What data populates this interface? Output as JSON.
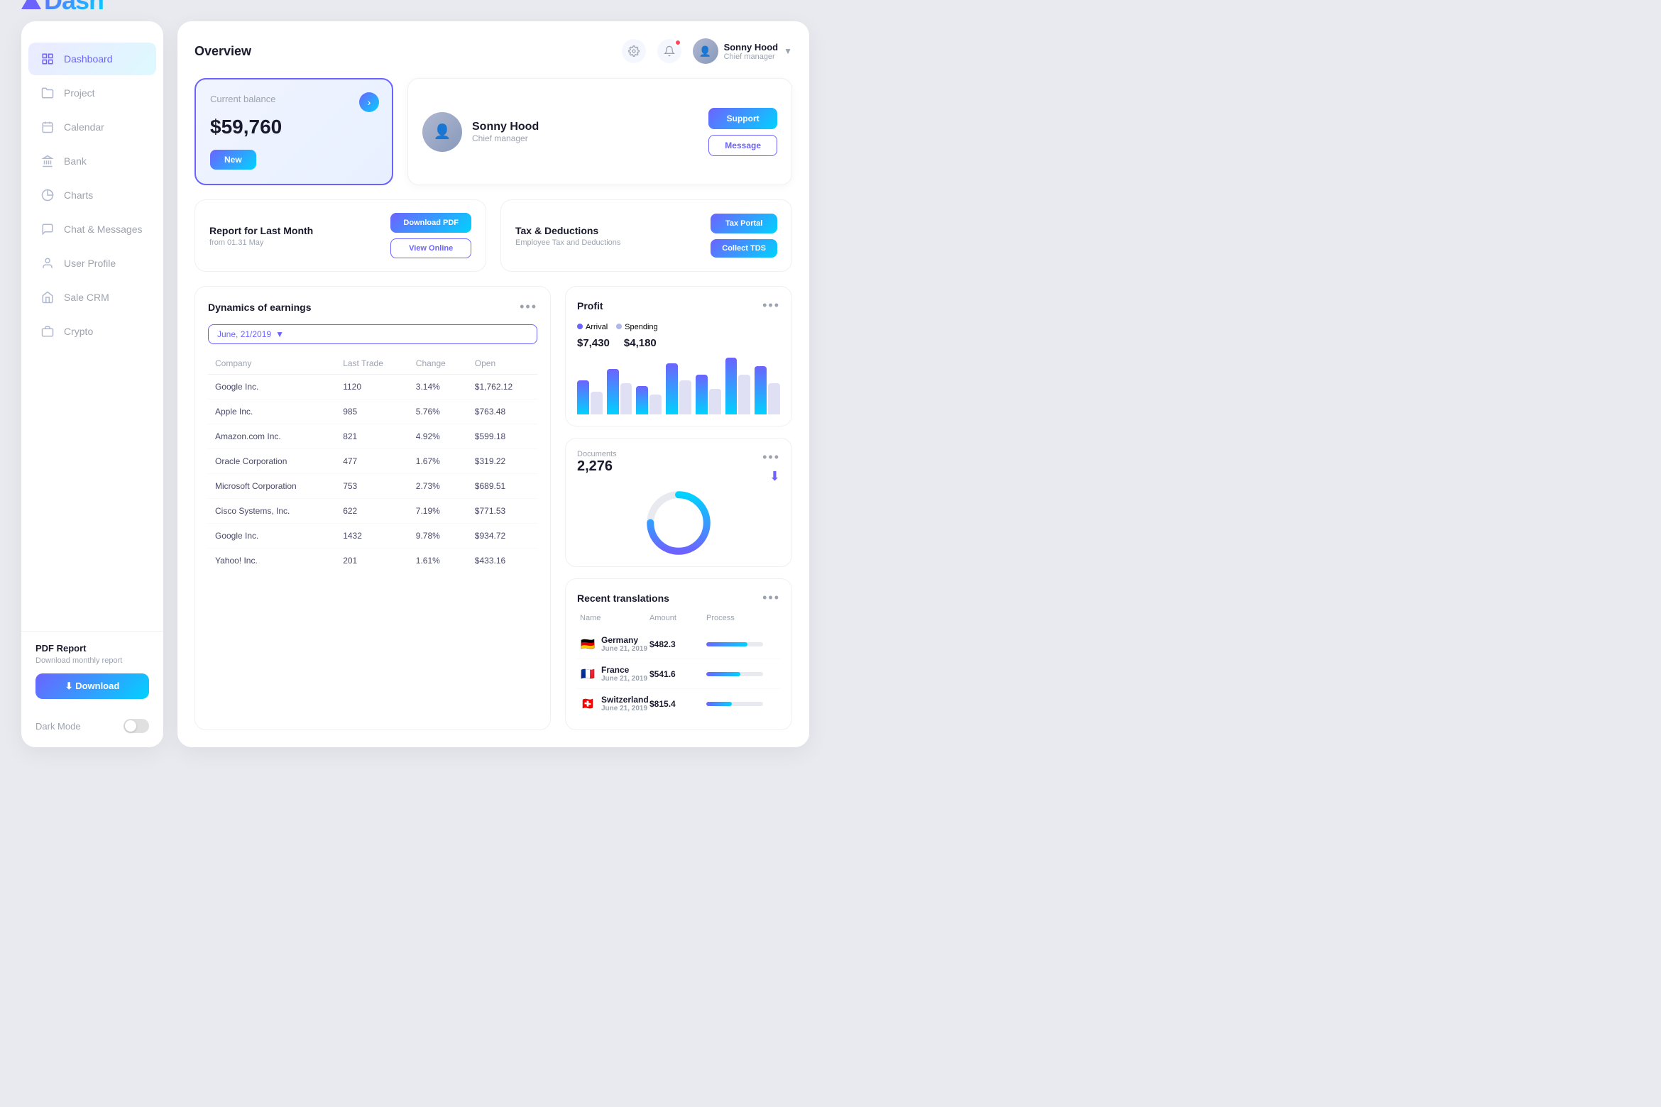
{
  "logo": {
    "text": "Dash"
  },
  "sidebar": {
    "items": [
      {
        "label": "Dashboard",
        "icon": "dashboard-icon",
        "active": true
      },
      {
        "label": "Project",
        "icon": "project-icon",
        "active": false
      },
      {
        "label": "Calendar",
        "icon": "calendar-icon",
        "active": false
      },
      {
        "label": "Bank",
        "icon": "bank-icon",
        "active": false
      },
      {
        "label": "Charts",
        "icon": "charts-icon",
        "active": false
      },
      {
        "label": "Chat & Messages",
        "icon": "chat-icon",
        "active": false
      },
      {
        "label": "User Profile",
        "icon": "user-icon",
        "active": false
      },
      {
        "label": "Sale CRM",
        "icon": "crm-icon",
        "active": false
      },
      {
        "label": "Crypto",
        "icon": "crypto-icon",
        "active": false
      }
    ],
    "pdf_report": {
      "title": "PDF Report",
      "subtitle": "Download monthly report",
      "button_label": "⬇ Download"
    },
    "dark_mode": {
      "label": "Dark Mode"
    }
  },
  "header": {
    "title": "Overview",
    "user": {
      "name": "Sonny Hood",
      "role": "Chief manager"
    }
  },
  "balance_card": {
    "label": "Current balance",
    "amount": "$59,760",
    "button_label": "New"
  },
  "user_card": {
    "name": "Sonny Hood",
    "role": "Chief manager",
    "support_btn": "Support",
    "message_btn": "Message"
  },
  "report_card": {
    "title": "Report for Last Month",
    "subtitle": "from 01.31 May",
    "download_btn": "Download PDF",
    "view_btn": "View Online"
  },
  "tax_card": {
    "title": "Tax & Deductions",
    "subtitle": "Employee Tax and Deductions",
    "portal_btn": "Tax Portal",
    "collect_btn": "Collect TDS"
  },
  "earnings": {
    "title": "Dynamics of earnings",
    "date_select": "June, 21/2019",
    "columns": [
      "Company",
      "Last Trade",
      "Change",
      "Open"
    ],
    "rows": [
      {
        "company": "Google Inc.",
        "last_trade": "1120",
        "change": "3.14%",
        "open": "$1,762.12"
      },
      {
        "company": "Apple Inc.",
        "last_trade": "985",
        "change": "5.76%",
        "open": "$763.48"
      },
      {
        "company": "Amazon.com Inc.",
        "last_trade": "821",
        "change": "4.92%",
        "open": "$599.18"
      },
      {
        "company": "Oracle Corporation",
        "last_trade": "477",
        "change": "1.67%",
        "open": "$319.22"
      },
      {
        "company": "Microsoft Corporation",
        "last_trade": "753",
        "change": "2.73%",
        "open": "$689.51"
      },
      {
        "company": "Cisco Systems, Inc.",
        "last_trade": "622",
        "change": "7.19%",
        "open": "$771.53"
      },
      {
        "company": "Google Inc.",
        "last_trade": "1432",
        "change": "9.78%",
        "open": "$934.72"
      },
      {
        "company": "Yahoo! Inc.",
        "last_trade": "201",
        "change": "1.61%",
        "open": "$433.16"
      }
    ]
  },
  "profit": {
    "title": "Profit",
    "arrival_label": "Arrival",
    "spending_label": "Spending",
    "arrival_value": "$7,430",
    "spending_value": "$4,180",
    "bars": [
      {
        "arrival": 60,
        "spending": 40
      },
      {
        "arrival": 80,
        "spending": 55
      },
      {
        "arrival": 50,
        "spending": 35
      },
      {
        "arrival": 90,
        "spending": 60
      },
      {
        "arrival": 70,
        "spending": 45
      },
      {
        "arrival": 100,
        "spending": 70
      },
      {
        "arrival": 85,
        "spending": 55
      }
    ]
  },
  "document": {
    "title": "Document",
    "label": "Documents",
    "count": "2,276",
    "donut_percent": 75
  },
  "translations": {
    "title": "Recent translations",
    "columns": [
      "Name",
      "Amount",
      "Process"
    ],
    "rows": [
      {
        "country": "Germany",
        "flag": "🇩🇪",
        "date": "June 21, 2019",
        "amount": "$482.3",
        "progress": 72
      },
      {
        "country": "France",
        "flag": "🇫🇷",
        "date": "June 21, 2019",
        "amount": "$541.6",
        "progress": 60
      },
      {
        "country": "Switzerland",
        "flag": "🇨🇭",
        "date": "June 21, 2019",
        "amount": "$815.4",
        "progress": 45
      }
    ]
  },
  "colors": {
    "primary": "#6c63ff",
    "secondary": "#00d2ff",
    "arrival": "#6c63ff",
    "spending": "#b0b8e8"
  }
}
